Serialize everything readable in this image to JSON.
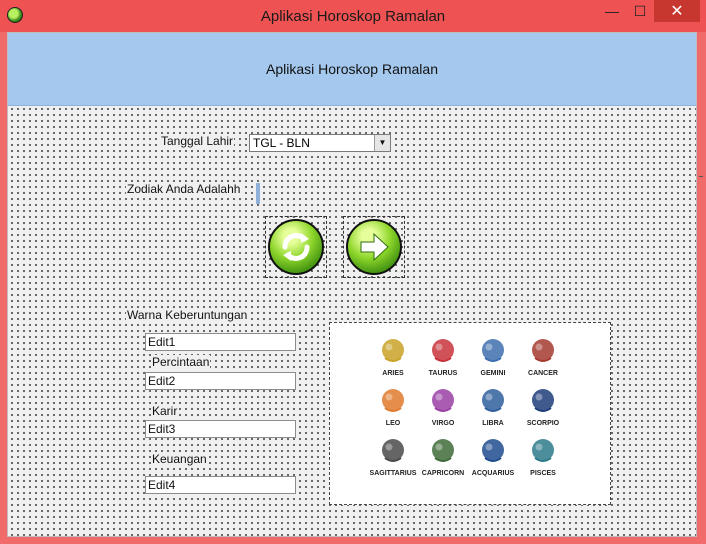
{
  "window": {
    "title": "Aplikasi Horoskop Ramalan",
    "minimize": "—",
    "maximize": "☐",
    "close": "✕"
  },
  "header": {
    "title": "Aplikasi Horoskop Ramalan"
  },
  "form": {
    "tanggal_label": "Tanggal Lahir",
    "tanggal_select": "TGL - BLN",
    "zodiak_label": "Zodiak Anda Adalahh",
    "zodiak_value": "",
    "warna_label": "Warna Keberuntungan",
    "edit1": "Edit1",
    "percintaan_label": "Percintaan",
    "edit2": "Edit2",
    "karir_label": "Karir",
    "edit3": "Edit3",
    "keuangan_label": "Keuangan",
    "edit4": "Edit4"
  },
  "buttons": {
    "refresh_icon": "refresh-icon",
    "next_icon": "arrow-right-icon"
  },
  "zodiac": [
    {
      "name": "ARIES",
      "color": "#c9a227"
    },
    {
      "name": "TAURUS",
      "color": "#c8333a"
    },
    {
      "name": "GEMINI",
      "color": "#3d6fae"
    },
    {
      "name": "CANCER",
      "color": "#a53a2f"
    },
    {
      "name": "LEO",
      "color": "#e07a2c"
    },
    {
      "name": "VIRGO",
      "color": "#9b3fa5"
    },
    {
      "name": "LIBRA",
      "color": "#2f5f9c"
    },
    {
      "name": "SCORPIO",
      "color": "#1f3d7a"
    },
    {
      "name": "SAGITTARIUS",
      "color": "#4a4a4a"
    },
    {
      "name": "CAPRICORN",
      "color": "#3f6b3a"
    },
    {
      "name": "ACQUARIUS",
      "color": "#1f4c8f"
    },
    {
      "name": "PISCES",
      "color": "#2d7a8a"
    }
  ]
}
